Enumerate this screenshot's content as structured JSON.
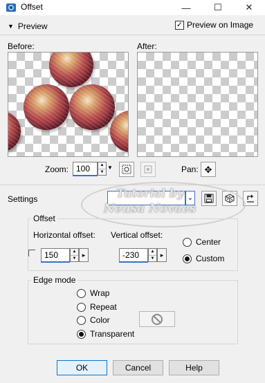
{
  "window": {
    "title": "Offset",
    "minimize_glyph": "—",
    "maximize_glyph": "☐",
    "close_glyph": "✕"
  },
  "preview": {
    "toggle_label": "Preview",
    "preview_on_image_label": "Preview on Image",
    "preview_on_image_checked": true,
    "before_label": "Before:",
    "after_label": "After:"
  },
  "zoom": {
    "label": "Zoom:",
    "value": "100",
    "pan_label": "Pan:"
  },
  "settings": {
    "label": "Settings",
    "preset_value": ""
  },
  "watermark": {
    "line1": "Tutorial by",
    "line2": "Neusa Novaes"
  },
  "offset": {
    "group_label": "Offset",
    "horizontal_label": "Horizontal offset:",
    "horizontal_value": "150",
    "vertical_label": "Vertical offset:",
    "vertical_value": "-230",
    "options": [
      {
        "label": "Center",
        "selected": false
      },
      {
        "label": "Custom",
        "selected": true
      }
    ]
  },
  "edge_mode": {
    "group_label": "Edge mode",
    "options": [
      {
        "label": "Wrap",
        "selected": false
      },
      {
        "label": "Repeat",
        "selected": false
      },
      {
        "label": "Color",
        "selected": false
      },
      {
        "label": "Transparent",
        "selected": true
      }
    ]
  },
  "buttons": {
    "ok": "OK",
    "cancel": "Cancel",
    "help": "Help"
  },
  "colors": {
    "accent": "#3b6fc3",
    "ok_border": "#0078d7"
  }
}
